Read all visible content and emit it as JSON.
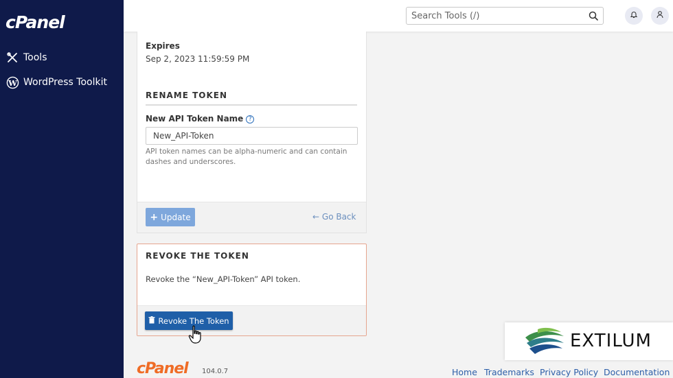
{
  "sidebar": {
    "logo": "cPanel",
    "items": [
      {
        "label": "Tools",
        "icon": "tools-icon"
      },
      {
        "label": "WordPress Toolkit",
        "icon": "wordpress-icon"
      }
    ]
  },
  "topbar": {
    "search_placeholder": "Search Tools (/)",
    "bell_icon": "bell-icon",
    "user_icon": "user-icon"
  },
  "token": {
    "expires_label": "Expires",
    "expires_value": "Sep 2, 2023 11:59:59 PM"
  },
  "rename": {
    "heading": "RENAME TOKEN",
    "field_label": "New API Token Name",
    "help_icon": "?",
    "field_value": "New_API-Token",
    "help_text": "API token names can be alpha-numeric and can contain dashes and underscores.",
    "update_label": "Update",
    "go_back_label": "Go Back"
  },
  "revoke": {
    "heading": "REVOKE THE TOKEN",
    "description": "Revoke the “New_API-Token” API token.",
    "button_label": "Revoke The Token"
  },
  "footer": {
    "logo": "cPanel",
    "version": "104.0.7",
    "links": [
      "Home",
      "Trademarks",
      "Privacy Policy",
      "Documentation"
    ]
  },
  "watermark": {
    "text": "EXTILUM"
  },
  "colors": {
    "sidebar_bg": "#0f1a4a",
    "primary": "#1f5fa8",
    "brand_orange": "#ef6c26",
    "revoke_border": "#e6a48e"
  }
}
